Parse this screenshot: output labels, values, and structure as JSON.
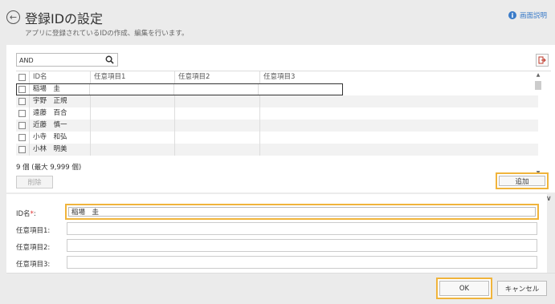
{
  "header": {
    "title": "登録IDの設定",
    "subtitle": "アプリに登録されているIDの作成、編集を行います。",
    "help_label": "画面説明"
  },
  "search": {
    "value": "AND"
  },
  "grid": {
    "columns": [
      "ID名",
      "任意項目1",
      "任意項目2",
      "任意項目3"
    ],
    "rows": [
      {
        "id_name": "稲場　圭",
        "f1": "",
        "f2": "",
        "f3": ""
      },
      {
        "id_name": "宇野　正規",
        "f1": "",
        "f2": "",
        "f3": ""
      },
      {
        "id_name": "遠藤　百合",
        "f1": "",
        "f2": "",
        "f3": ""
      },
      {
        "id_name": "近藤　慎一",
        "f1": "",
        "f2": "",
        "f3": ""
      },
      {
        "id_name": "小寺　和弘",
        "f1": "",
        "f2": "",
        "f3": ""
      },
      {
        "id_name": "小林　明美",
        "f1": "",
        "f2": "",
        "f3": ""
      }
    ],
    "count_text": "9 個 (最大 9,999 個)"
  },
  "buttons": {
    "delete": "削除",
    "add": "追加",
    "ok": "OK",
    "cancel": "キャンセル"
  },
  "form": {
    "id_label": "ID名",
    "required_mark": "*",
    "id_label_colon": ":",
    "id_value": "稲場　圭",
    "field1_label": "任意項目1:",
    "field2_label": "任意項目2:",
    "field3_label": "任意項目3:",
    "field1_value": "",
    "field2_value": "",
    "field3_value": ""
  },
  "colors": {
    "highlight": "#f0b43c",
    "link": "#3a7bc8",
    "required": "#e03030"
  }
}
